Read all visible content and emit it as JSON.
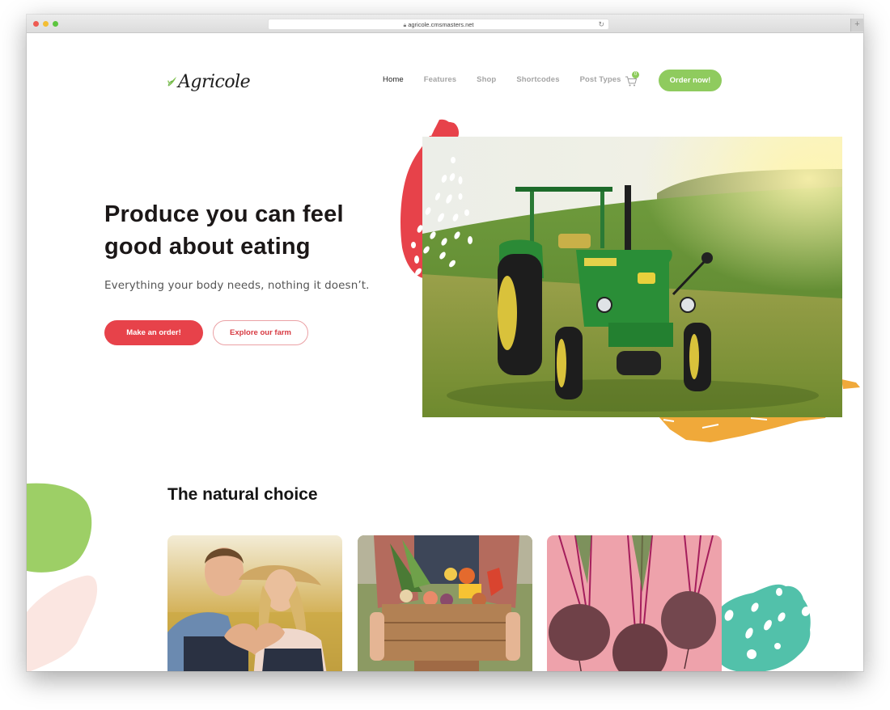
{
  "browser": {
    "url": "agricole.cmsmasters.net",
    "new_tab_label": "+"
  },
  "header": {
    "logo_text": "Agricole",
    "nav": [
      {
        "label": "Home",
        "active": true
      },
      {
        "label": "Features",
        "active": false
      },
      {
        "label": "Shop",
        "active": false
      },
      {
        "label": "Shortcodes",
        "active": false
      },
      {
        "label": "Post Types",
        "active": false
      }
    ],
    "cart_count": "0",
    "cta_label": "Order now!"
  },
  "hero": {
    "title": "Produce you can feel good about eating",
    "subtitle": "Everything your body needs, nothing it doesn’t.",
    "primary_button": "Make an order!",
    "secondary_button": "Explore our farm",
    "image_alt": "Green tractor in a sunlit grass field"
  },
  "section": {
    "title": "The natural choice",
    "cards": [
      {
        "image_alt": "Smiling farmer couple making a heart with their hands"
      },
      {
        "image_alt": "Farmer holding a wooden crate of fresh vegetables"
      },
      {
        "image_alt": "Three beets on a pink background"
      }
    ]
  },
  "colors": {
    "brand_green": "#8fcb5e",
    "accent_red": "#e7424a",
    "accent_orange": "#f0a93a",
    "accent_teal": "#52c1aa",
    "blush": "#fbe6e1"
  }
}
